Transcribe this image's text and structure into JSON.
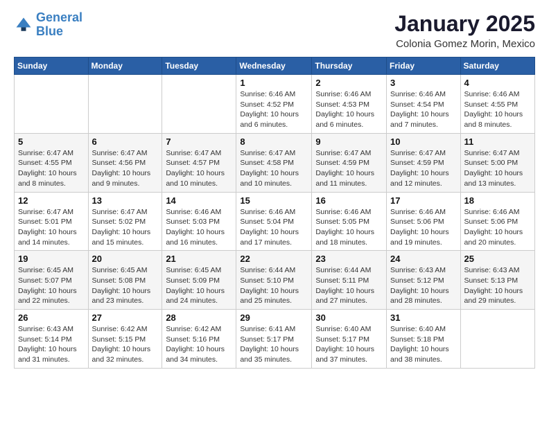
{
  "logo": {
    "line1": "General",
    "line2": "Blue"
  },
  "header": {
    "title": "January 2025",
    "subtitle": "Colonia Gomez Morin, Mexico"
  },
  "days_of_week": [
    "Sunday",
    "Monday",
    "Tuesday",
    "Wednesday",
    "Thursday",
    "Friday",
    "Saturday"
  ],
  "weeks": [
    [
      {
        "day": "",
        "info": ""
      },
      {
        "day": "",
        "info": ""
      },
      {
        "day": "",
        "info": ""
      },
      {
        "day": "1",
        "info": "Sunrise: 6:46 AM\nSunset: 4:52 PM\nDaylight: 10 hours\nand 6 minutes."
      },
      {
        "day": "2",
        "info": "Sunrise: 6:46 AM\nSunset: 4:53 PM\nDaylight: 10 hours\nand 6 minutes."
      },
      {
        "day": "3",
        "info": "Sunrise: 6:46 AM\nSunset: 4:54 PM\nDaylight: 10 hours\nand 7 minutes."
      },
      {
        "day": "4",
        "info": "Sunrise: 6:46 AM\nSunset: 4:55 PM\nDaylight: 10 hours\nand 8 minutes."
      }
    ],
    [
      {
        "day": "5",
        "info": "Sunrise: 6:47 AM\nSunset: 4:55 PM\nDaylight: 10 hours\nand 8 minutes."
      },
      {
        "day": "6",
        "info": "Sunrise: 6:47 AM\nSunset: 4:56 PM\nDaylight: 10 hours\nand 9 minutes."
      },
      {
        "day": "7",
        "info": "Sunrise: 6:47 AM\nSunset: 4:57 PM\nDaylight: 10 hours\nand 10 minutes."
      },
      {
        "day": "8",
        "info": "Sunrise: 6:47 AM\nSunset: 4:58 PM\nDaylight: 10 hours\nand 10 minutes."
      },
      {
        "day": "9",
        "info": "Sunrise: 6:47 AM\nSunset: 4:59 PM\nDaylight: 10 hours\nand 11 minutes."
      },
      {
        "day": "10",
        "info": "Sunrise: 6:47 AM\nSunset: 4:59 PM\nDaylight: 10 hours\nand 12 minutes."
      },
      {
        "day": "11",
        "info": "Sunrise: 6:47 AM\nSunset: 5:00 PM\nDaylight: 10 hours\nand 13 minutes."
      }
    ],
    [
      {
        "day": "12",
        "info": "Sunrise: 6:47 AM\nSunset: 5:01 PM\nDaylight: 10 hours\nand 14 minutes."
      },
      {
        "day": "13",
        "info": "Sunrise: 6:47 AM\nSunset: 5:02 PM\nDaylight: 10 hours\nand 15 minutes."
      },
      {
        "day": "14",
        "info": "Sunrise: 6:46 AM\nSunset: 5:03 PM\nDaylight: 10 hours\nand 16 minutes."
      },
      {
        "day": "15",
        "info": "Sunrise: 6:46 AM\nSunset: 5:04 PM\nDaylight: 10 hours\nand 17 minutes."
      },
      {
        "day": "16",
        "info": "Sunrise: 6:46 AM\nSunset: 5:05 PM\nDaylight: 10 hours\nand 18 minutes."
      },
      {
        "day": "17",
        "info": "Sunrise: 6:46 AM\nSunset: 5:06 PM\nDaylight: 10 hours\nand 19 minutes."
      },
      {
        "day": "18",
        "info": "Sunrise: 6:46 AM\nSunset: 5:06 PM\nDaylight: 10 hours\nand 20 minutes."
      }
    ],
    [
      {
        "day": "19",
        "info": "Sunrise: 6:45 AM\nSunset: 5:07 PM\nDaylight: 10 hours\nand 22 minutes."
      },
      {
        "day": "20",
        "info": "Sunrise: 6:45 AM\nSunset: 5:08 PM\nDaylight: 10 hours\nand 23 minutes."
      },
      {
        "day": "21",
        "info": "Sunrise: 6:45 AM\nSunset: 5:09 PM\nDaylight: 10 hours\nand 24 minutes."
      },
      {
        "day": "22",
        "info": "Sunrise: 6:44 AM\nSunset: 5:10 PM\nDaylight: 10 hours\nand 25 minutes."
      },
      {
        "day": "23",
        "info": "Sunrise: 6:44 AM\nSunset: 5:11 PM\nDaylight: 10 hours\nand 27 minutes."
      },
      {
        "day": "24",
        "info": "Sunrise: 6:43 AM\nSunset: 5:12 PM\nDaylight: 10 hours\nand 28 minutes."
      },
      {
        "day": "25",
        "info": "Sunrise: 6:43 AM\nSunset: 5:13 PM\nDaylight: 10 hours\nand 29 minutes."
      }
    ],
    [
      {
        "day": "26",
        "info": "Sunrise: 6:43 AM\nSunset: 5:14 PM\nDaylight: 10 hours\nand 31 minutes."
      },
      {
        "day": "27",
        "info": "Sunrise: 6:42 AM\nSunset: 5:15 PM\nDaylight: 10 hours\nand 32 minutes."
      },
      {
        "day": "28",
        "info": "Sunrise: 6:42 AM\nSunset: 5:16 PM\nDaylight: 10 hours\nand 34 minutes."
      },
      {
        "day": "29",
        "info": "Sunrise: 6:41 AM\nSunset: 5:17 PM\nDaylight: 10 hours\nand 35 minutes."
      },
      {
        "day": "30",
        "info": "Sunrise: 6:40 AM\nSunset: 5:17 PM\nDaylight: 10 hours\nand 37 minutes."
      },
      {
        "day": "31",
        "info": "Sunrise: 6:40 AM\nSunset: 5:18 PM\nDaylight: 10 hours\nand 38 minutes."
      },
      {
        "day": "",
        "info": ""
      }
    ]
  ]
}
